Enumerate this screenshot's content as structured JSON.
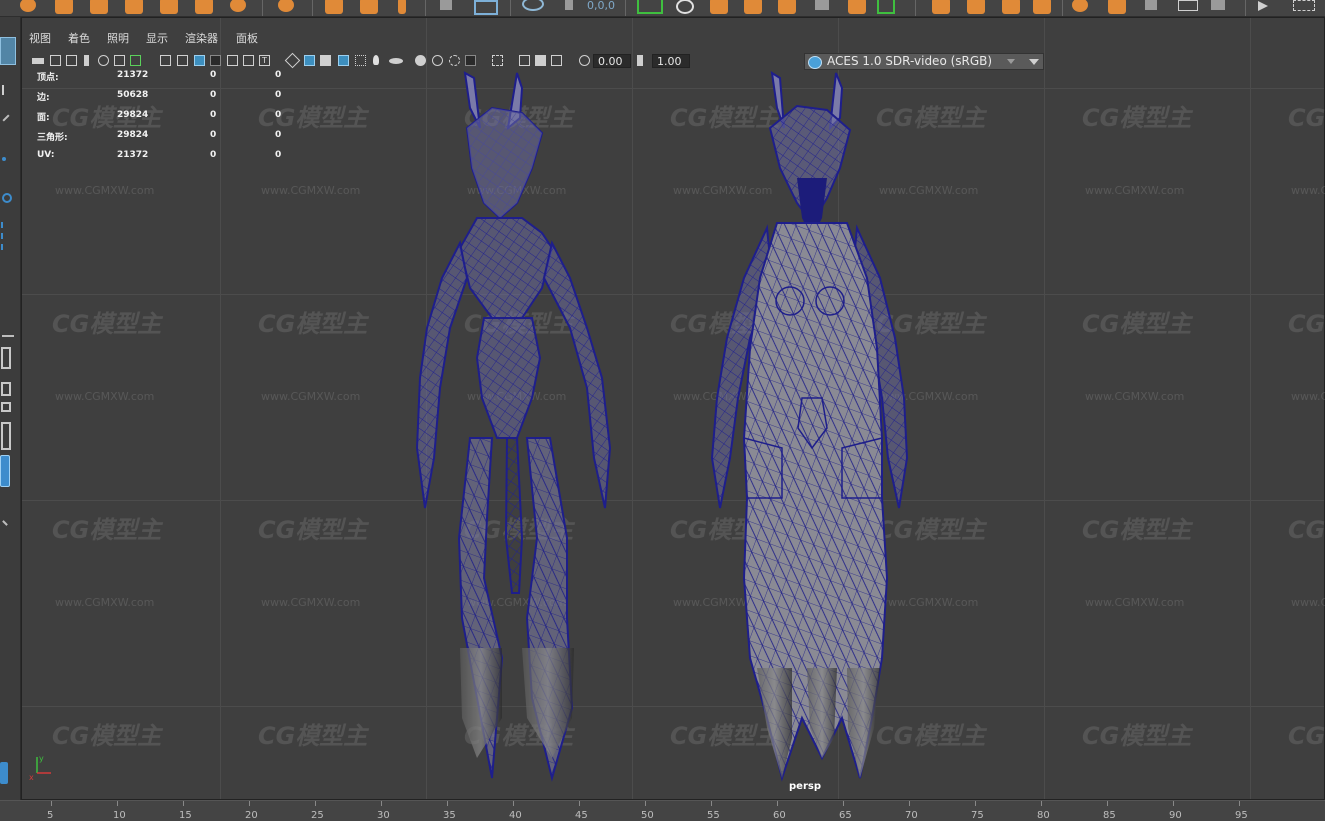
{
  "panel_menu": [
    "视图",
    "着色",
    "照明",
    "显示",
    "渲染器",
    "面板"
  ],
  "shelf": {
    "coords_readout": "0,0,0"
  },
  "panel_toolbar": {
    "exposure_value": "0.00",
    "gamma_value": "1.00",
    "color_space": "ACES 1.0 SDR-video (sRGB)"
  },
  "hud": {
    "rows": [
      {
        "label": "顶点:",
        "value": "21372",
        "col2": "0",
        "col3": "0"
      },
      {
        "label": "边:",
        "value": "50628",
        "col2": "0",
        "col3": "0"
      },
      {
        "label": "面:",
        "value": "29824",
        "col2": "0",
        "col3": "0"
      },
      {
        "label": "三角形:",
        "value": "29824",
        "col2": "0",
        "col3": "0"
      },
      {
        "label": "UV:",
        "value": "21372",
        "col2": "0",
        "col3": "0"
      }
    ]
  },
  "viewport": {
    "camera_label": "persp",
    "axis_labels": {
      "x": "x",
      "y": "y"
    }
  },
  "watermark": {
    "logo_text": "CG模型主",
    "url_text": "www.CGMXW.com"
  },
  "timeline": {
    "ticks": [
      "5",
      "10",
      "15",
      "20",
      "25",
      "30",
      "35",
      "40",
      "45",
      "50",
      "55",
      "60",
      "65",
      "70",
      "75",
      "80",
      "85",
      "90",
      "95"
    ]
  },
  "colors": {
    "viewport_bg": "#3f3f3f",
    "wireframe": "#1e1e8c",
    "shelf_orange": "#e08a38",
    "accent_blue": "#3d8fbf"
  }
}
